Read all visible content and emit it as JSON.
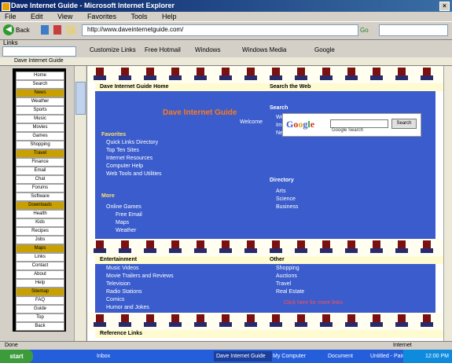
{
  "window": {
    "title": "Dave Internet Guide - Microsoft Internet Explorer"
  },
  "menu": [
    "File",
    "Edit",
    "View",
    "Favorites",
    "Tools",
    "Help"
  ],
  "toolbar": {
    "back": "Back",
    "url": "http://www.daveinternetguide.com/",
    "go": "Go"
  },
  "links_bar": {
    "address_label": "Links",
    "items": [
      "Customize Links",
      "Free Hotmail",
      "Windows",
      "Windows Media",
      "Google"
    ]
  },
  "tab": {
    "label": "Dave Internet Guide"
  },
  "sidebar": {
    "items": [
      "Home",
      "Search",
      "News",
      "Weather",
      "Sports",
      "Music",
      "Movies",
      "Games",
      "Shopping",
      "Travel",
      "Finance",
      "Email",
      "Chat",
      "Forums",
      "Software",
      "Downloads",
      "Health",
      "Kids",
      "Recipes",
      "Jobs",
      "Maps",
      "Links",
      "Contact",
      "About",
      "Help",
      "Sitemap",
      "FAQ",
      "Guide",
      "Top",
      "Back"
    ]
  },
  "content": {
    "header1": {
      "left": "Dave Internet Guide Home",
      "right": "Search the Web"
    },
    "site_title": "Dave Internet Guide",
    "tagline": "Welcome",
    "links_section": {
      "heading": "Favorites",
      "items": [
        "Quick Links Directory",
        "Top Ten Sites",
        "Internet Resources",
        "Computer Help",
        "Web Tools and Utilities"
      ]
    },
    "more_section": {
      "heading": "More",
      "items": [
        "Online Games",
        "Free Email",
        "Maps",
        "Weather"
      ]
    },
    "right_col": {
      "heading": "Search",
      "items": [
        "Web",
        "Images",
        "News"
      ],
      "heading2": "Directory",
      "items2": [
        "Arts",
        "Science",
        "Business"
      ]
    },
    "google": {
      "button": "Search",
      "sub": "Google Search"
    },
    "header2": {
      "left": "Entertainment",
      "right": "Other"
    },
    "ent_items": [
      "Music Videos",
      "Movie Trailers and Reviews",
      "Television",
      "Radio Stations",
      "Comics",
      "Humor and Jokes"
    ],
    "other_items": [
      "Shopping",
      "Auctions",
      "Travel",
      "Real Estate"
    ],
    "other_note": "Click here for more links",
    "header3": {
      "left": "Reference Links"
    }
  },
  "status": {
    "left": "Done",
    "right": "Internet"
  },
  "taskbar": {
    "start": "start",
    "tasks": [
      "Inbox",
      "Dave Internet Guide",
      "My Computer",
      "Document",
      "Untitled - Paint"
    ],
    "clock": "12:00 PM"
  }
}
